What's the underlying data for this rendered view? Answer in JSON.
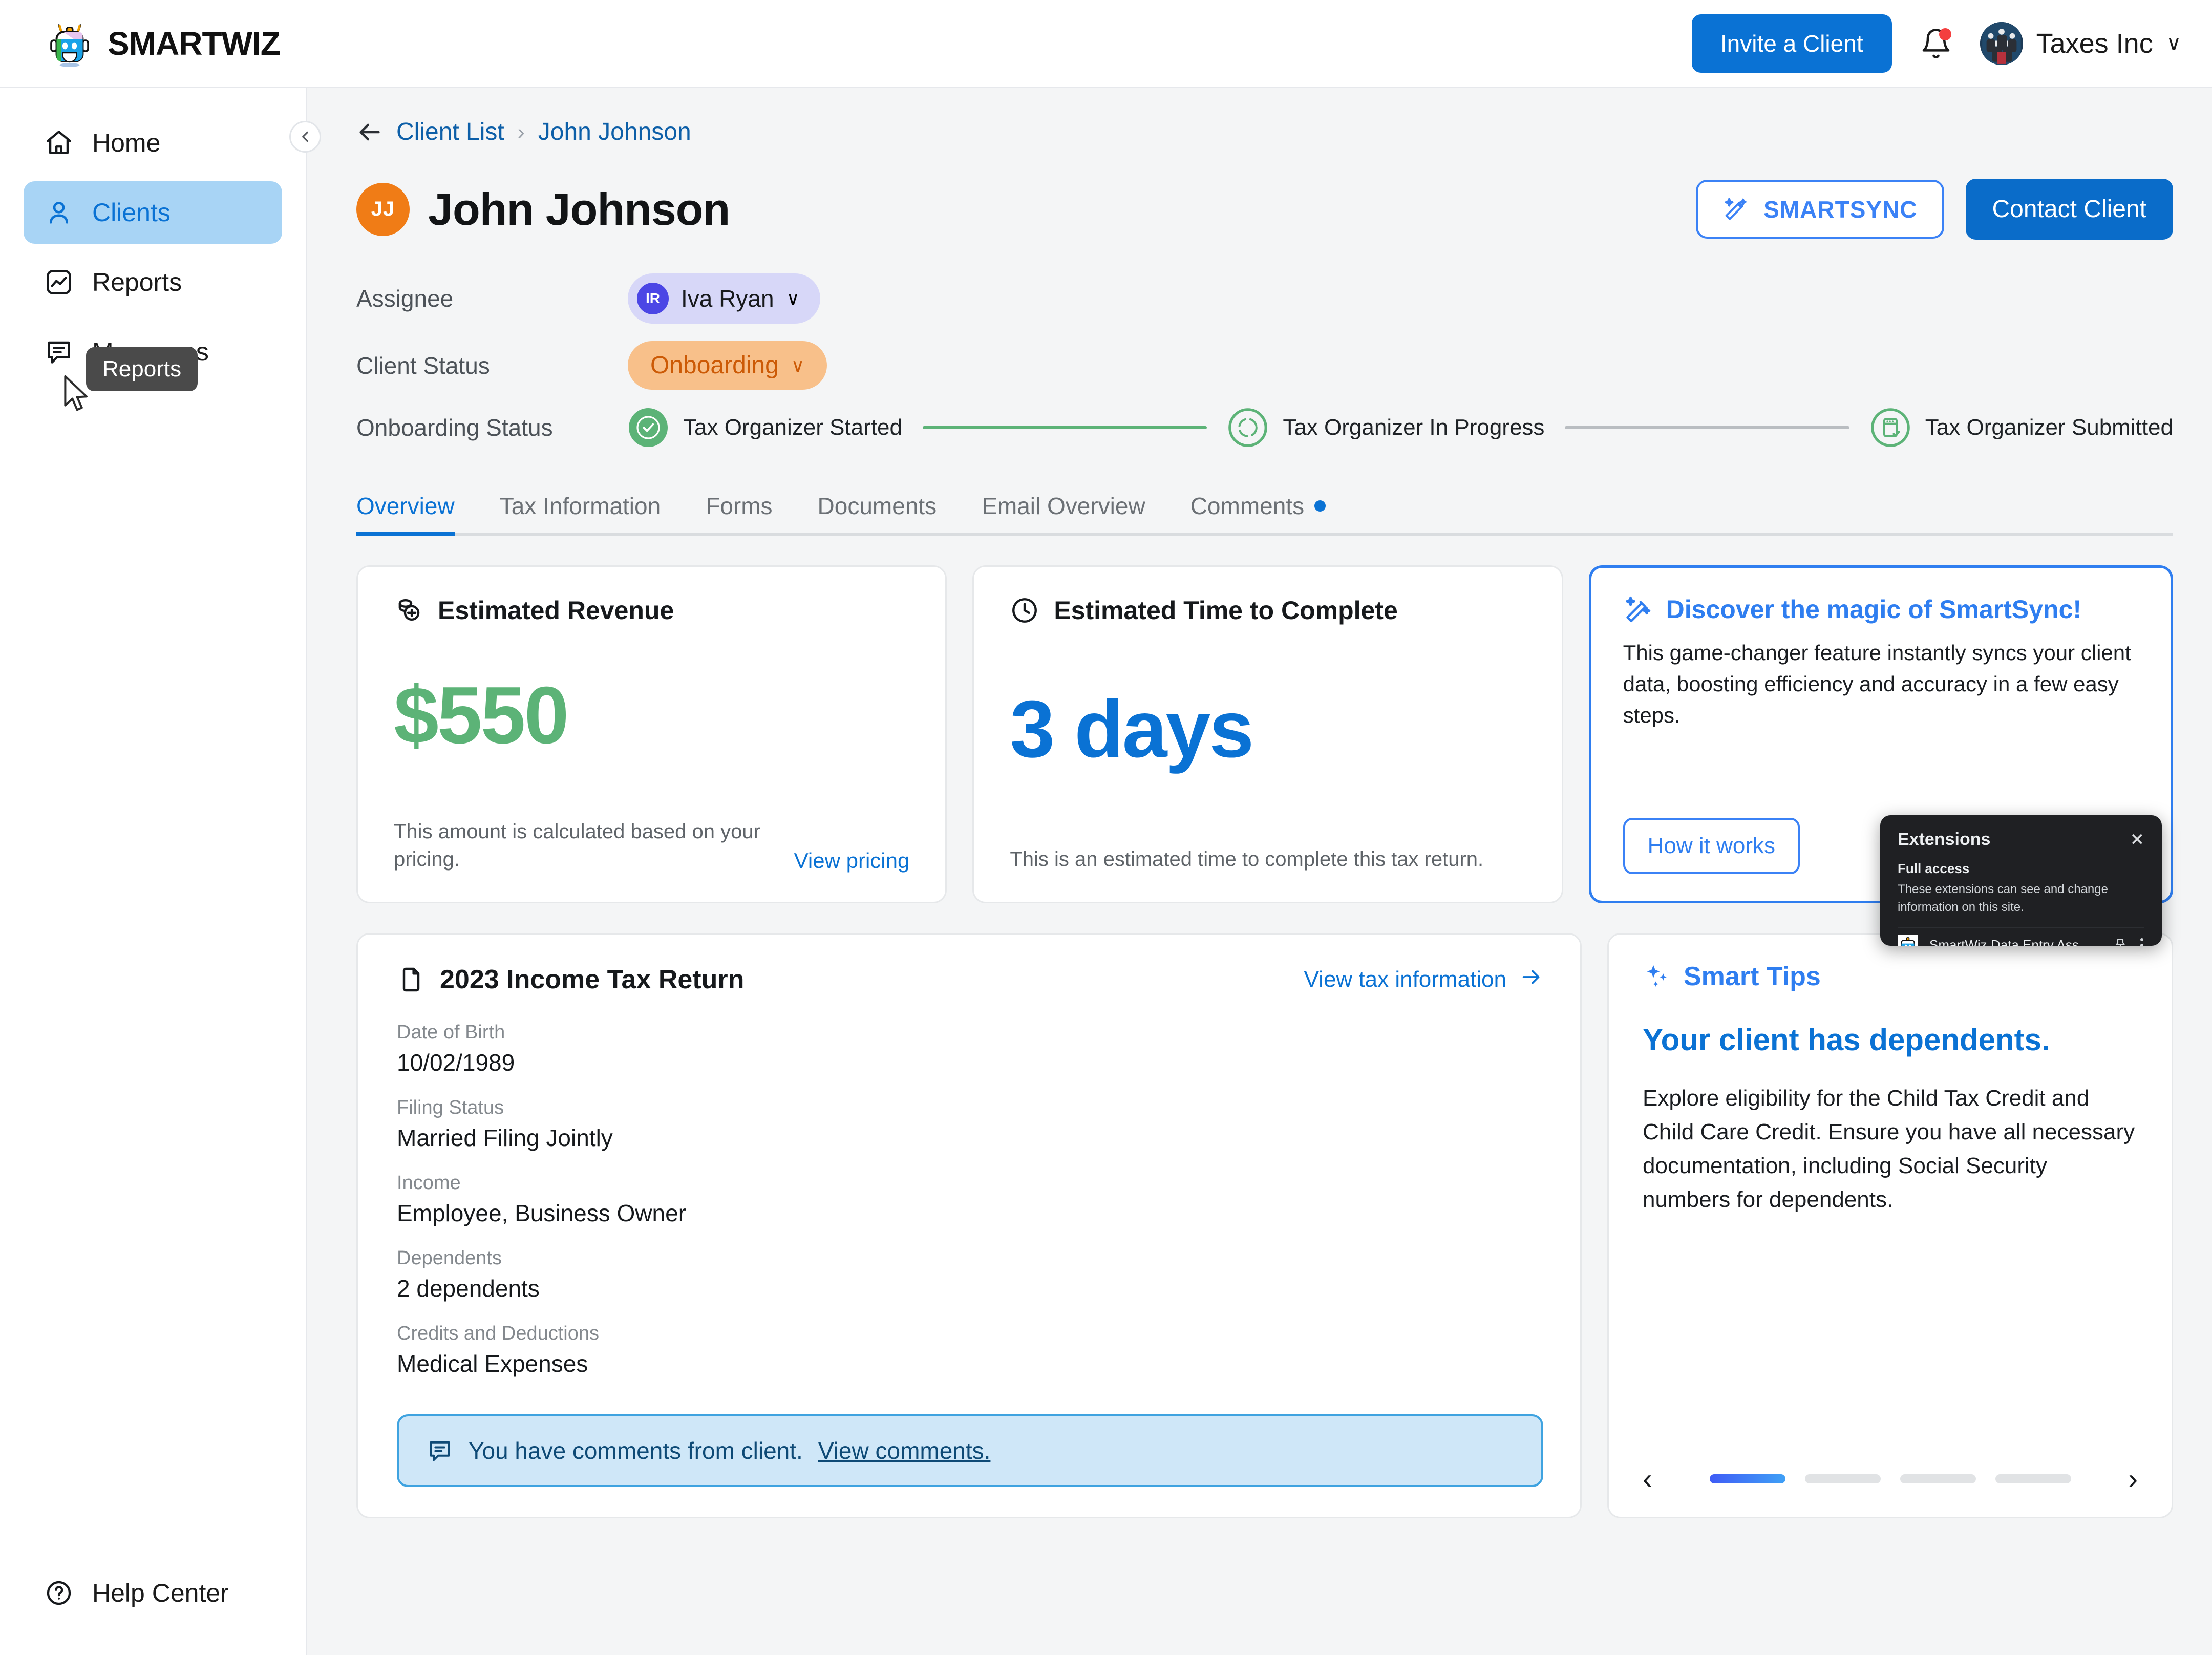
{
  "brand": {
    "name_light": "SMART",
    "name_bold": "WIZ",
    "logo_icon": "robot-logo"
  },
  "topbar": {
    "invite_label": "Invite a Client",
    "notifications_icon": "bell-icon",
    "org_name": "Taxes Inc",
    "org_caret": "∨"
  },
  "sidebar": {
    "items": [
      {
        "label": "Home",
        "icon": "home-icon",
        "active": false
      },
      {
        "label": "Clients",
        "icon": "user-icon",
        "active": true
      },
      {
        "label": "Reports",
        "icon": "chart-image-icon",
        "active": false
      },
      {
        "label": "Messages",
        "icon": "chat-icon",
        "active": false
      }
    ],
    "tooltip": "Reports",
    "help": {
      "label": "Help Center",
      "icon": "question-circle-icon"
    },
    "collapse_icon": "chevron-left-icon"
  },
  "breadcrumb": {
    "back_icon": "arrow-left-icon",
    "parent": "Client List",
    "separator": "›",
    "current": "John Johnson"
  },
  "client": {
    "initials": "JJ",
    "name": "John Johnson",
    "smartsync_label": "SMARTSYNC",
    "contact_label": "Contact Client"
  },
  "meta": {
    "assignee_label": "Assignee",
    "assignee_initials": "IR",
    "assignee_name": "Iva Ryan",
    "status_label": "Client Status",
    "status_value": "Onboarding",
    "onboarding_label": "Onboarding Status",
    "steps": [
      {
        "label": "Tax Organizer Started",
        "state": "complete",
        "icon": "check-circle-icon"
      },
      {
        "label": "Tax Organizer In Progress",
        "state": "current",
        "icon": "spinner-circle-icon"
      },
      {
        "label": "Tax Organizer Submitted",
        "state": "upcoming",
        "icon": "document-check-icon"
      }
    ]
  },
  "tabs": [
    {
      "label": "Overview",
      "active": true,
      "dot": false
    },
    {
      "label": "Tax Information",
      "active": false,
      "dot": false
    },
    {
      "label": "Forms",
      "active": false,
      "dot": false
    },
    {
      "label": "Documents",
      "active": false,
      "dot": false
    },
    {
      "label": "Email Overview",
      "active": false,
      "dot": false
    },
    {
      "label": "Comments",
      "active": false,
      "dot": true
    }
  ],
  "revenue_card": {
    "icon": "coins-icon",
    "title": "Estimated Revenue",
    "value": "$550",
    "note": "This amount is calculated based on your pricing.",
    "link": "View pricing"
  },
  "time_card": {
    "icon": "clock-icon",
    "title": "Estimated Time to Complete",
    "value": "3 days",
    "note": "This is an estimated time to complete this tax return."
  },
  "promo_card": {
    "icon": "magic-wand-icon",
    "title": "Discover the magic of SmartSync!",
    "body": "This game-changer feature instantly syncs your client data, boosting efficiency and accuracy in a few easy steps.",
    "button": "How it works"
  },
  "return_card": {
    "icon": "file-icon",
    "title": "2023 Income Tax Return",
    "link": "View tax information",
    "link_icon": "arrow-right-icon",
    "fields": [
      {
        "label": "Date of Birth",
        "value": "10/02/1989"
      },
      {
        "label": "Filing Status",
        "value": "Married Filing Jointly"
      },
      {
        "label": "Income",
        "value": "Employee, Business Owner"
      },
      {
        "label": "Dependents",
        "value": "2 dependents"
      },
      {
        "label": "Credits and Deductions",
        "value": "Medical Expenses"
      }
    ],
    "banner": {
      "icon": "comment-icon",
      "text": "You have comments from client.",
      "link": "View comments."
    }
  },
  "tips_card": {
    "icon": "sparkles-icon",
    "title": "Smart Tips",
    "headline": "Your client has dependents.",
    "body": "Explore eligibility for the Child Tax Credit and Child Care Credit. Ensure you have all necessary documentation, including Social Security numbers for dependents.",
    "prev_icon": "chevron-left-icon",
    "next_icon": "chevron-right-icon",
    "prev_glyph": "‹",
    "next_glyph": "›",
    "slide_count": 4,
    "active_slide": 1
  },
  "extensions_popup": {
    "title": "Extensions",
    "close_glyph": "✕",
    "section": "Full access",
    "description": "These extensions can see and change information on this site.",
    "item_name": "SmartWiz Data Entry Ass…",
    "item_icon": "robot-icon",
    "pin_icon": "pin-icon",
    "menu_icon": "kebab-menu-icon"
  },
  "colors": {
    "accent_blue": "#0a72d4",
    "promo_blue": "#2f7ef0",
    "green": "#5cb377",
    "orange": "#f07c16",
    "status_orange_bg": "#f8c08a",
    "status_orange_text": "#cc5a06",
    "assignee_purple_bg": "#d7d7f8",
    "assignee_purple": "#4b46e5"
  }
}
